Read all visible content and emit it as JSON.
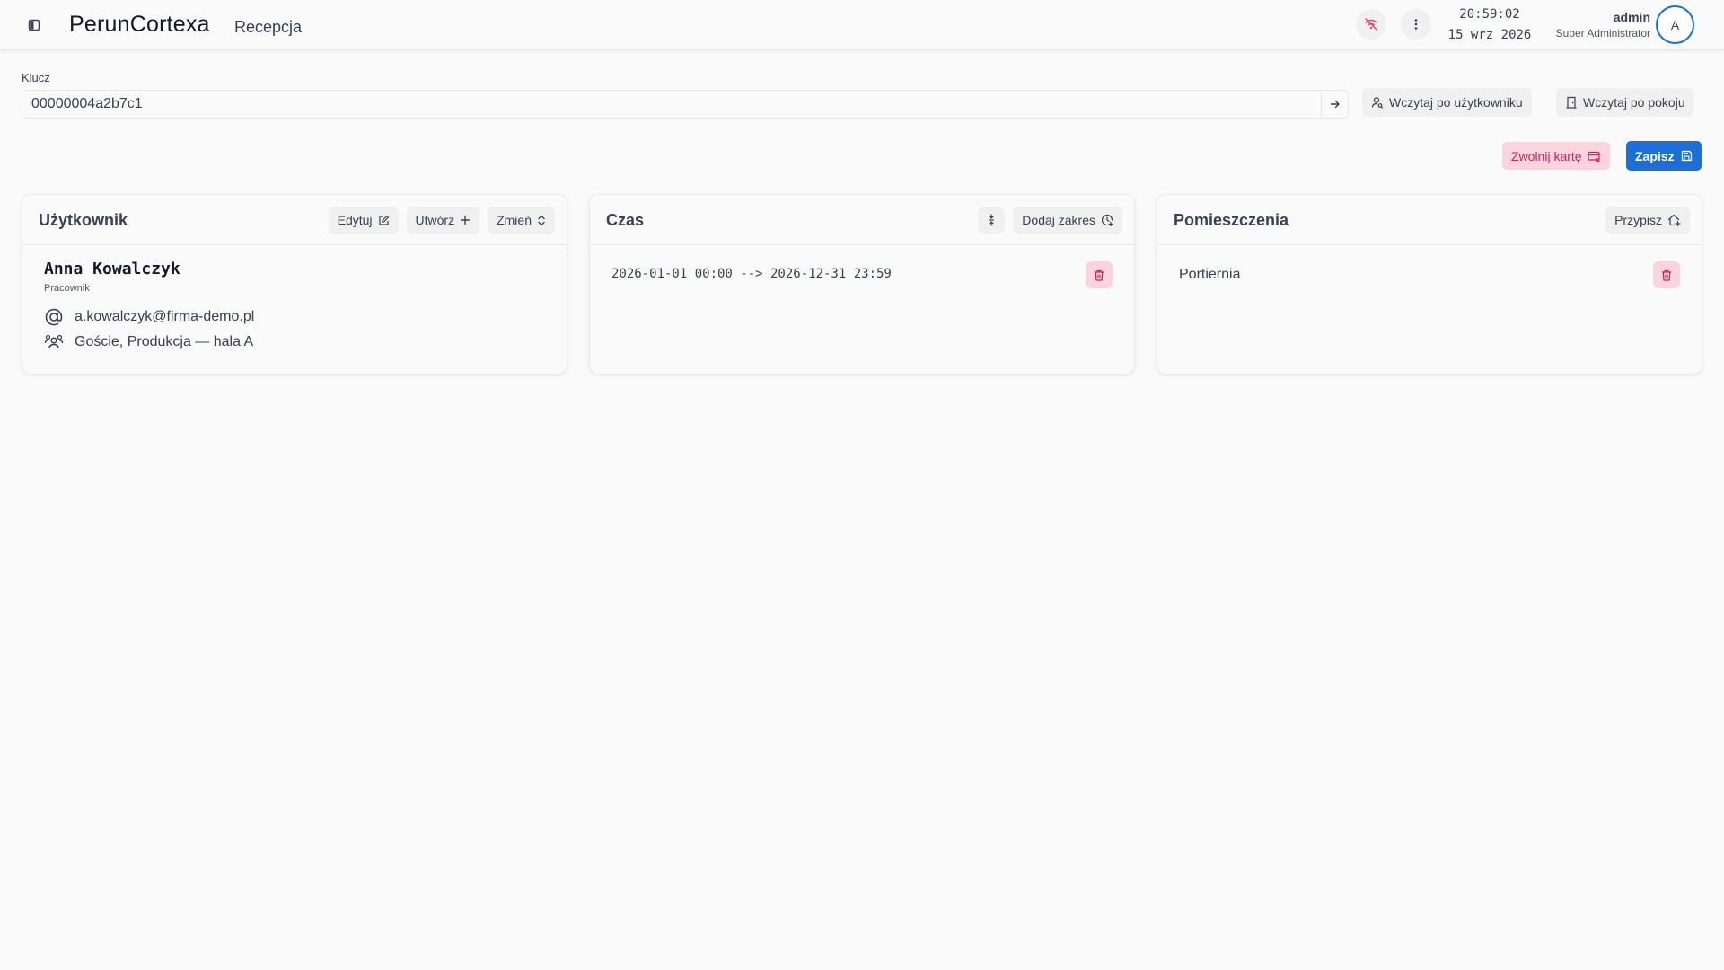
{
  "header": {
    "app_title": "PerunCortexa",
    "page_subtitle": "Recepcja",
    "clock_time": "20:59:02",
    "clock_date": "15 wrz 2026",
    "user_name": "admin",
    "user_role": "Super Administrator",
    "avatar_letter": "A",
    "icons": [
      "sidebar-toggle-icon",
      "wifi-off-icon",
      "more-vertical-icon"
    ]
  },
  "key": {
    "label": "Klucz",
    "value": "00000004a2b7c1",
    "load_by_user_label": "Wczytaj po użytkowniku",
    "load_by_room_label": "Wczytaj po pokoju"
  },
  "actions": {
    "release_label": "Zwolnij kartę",
    "save_label": "Zapisz"
  },
  "user_card": {
    "title": "Użytkownik",
    "edit_label": "Edytuj",
    "create_label": "Utwórz",
    "change_label": "Zmień",
    "name": "Anna Kowalczyk",
    "role": "Pracownik",
    "email": "a.kowalczyk@firma-demo.pl",
    "groups": "Goście, Produkcja — hala A"
  },
  "time_card": {
    "title": "Czas",
    "add_range_label": "Dodaj zakres",
    "ranges": [
      "2026-01-01 00:00 --> 2026-12-31 23:59"
    ]
  },
  "rooms_card": {
    "title": "Pomieszczenia",
    "assign_label": "Przypisz",
    "rooms": [
      "Portiernia"
    ]
  },
  "colors": {
    "accent": "#1d6fd8",
    "danger_bg": "#fbd4de",
    "danger_fg": "#c8245b",
    "background": "#fafafa"
  }
}
